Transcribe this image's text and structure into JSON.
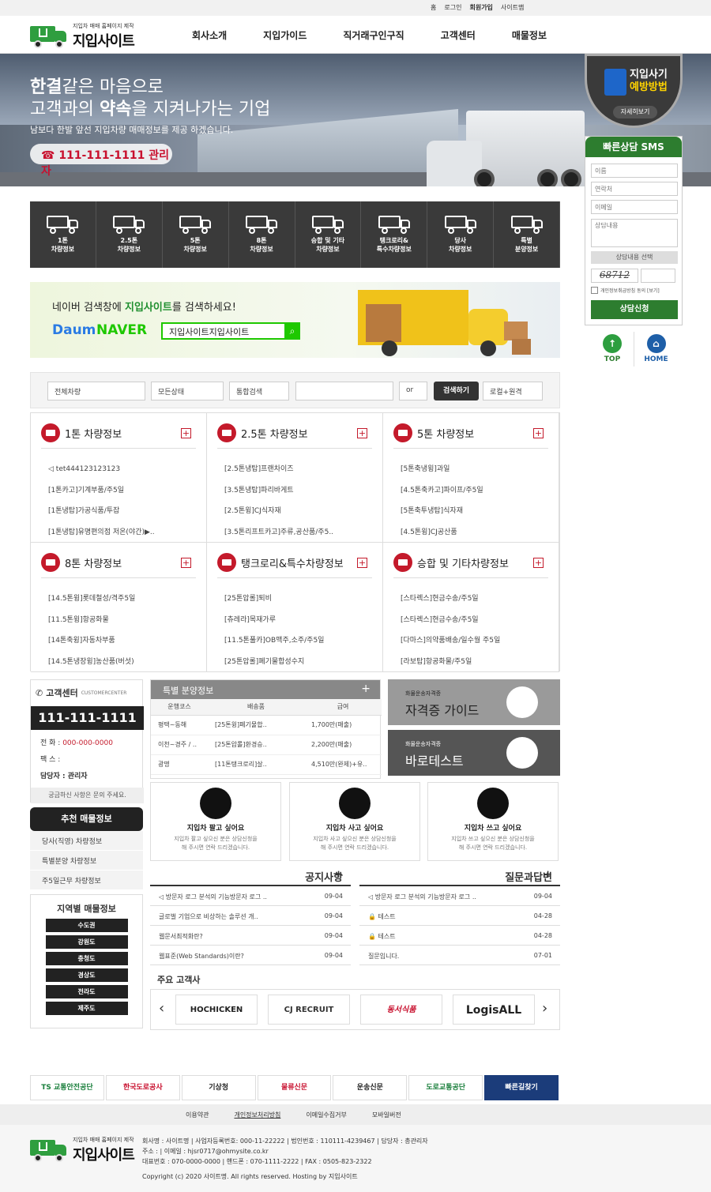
{
  "topbar": {
    "links": [
      "홈",
      "로그인",
      "회원가입",
      "사이트맵"
    ]
  },
  "logo": {
    "small": "지입차 매매 홈페이지 제작",
    "big": "지입사이트"
  },
  "gnb": [
    "회사소개",
    "지입가이드",
    "직거래구인구직",
    "고객센터",
    "매물정보"
  ],
  "hero": {
    "line1_bold": "한결",
    "line1_rest": "같은 마음으로",
    "line2_pre": "고객과의 ",
    "line2_bold": "약속",
    "line2_rest": "을 지켜나가는 기업",
    "sub": "남보다 한발 앞선 지입차량 매매정보를 제공 하겠습니다.",
    "phone": "☎ 111-111-1111 관리자"
  },
  "fraud": {
    "l1": "지입사기",
    "l2": "예방방법",
    "btn": "자세히보기"
  },
  "sms": {
    "title": "빠른상담 SMS",
    "name_ph": "이름",
    "phone_ph": "연락처",
    "email_ph": "이메일",
    "msg_ph": "상담내용",
    "select": "상담내용 선택",
    "captcha": "68712",
    "agree": "개인정보취급방침 동의 [보기]",
    "submit": "상담신청"
  },
  "quick": {
    "top": "TOP",
    "home": "HOME"
  },
  "categories": [
    {
      "l1": "1톤",
      "l2": "차량정보"
    },
    {
      "l1": "2.5톤",
      "l2": "차량정보"
    },
    {
      "l1": "5톤",
      "l2": "차량정보"
    },
    {
      "l1": "8톤",
      "l2": "차량정보"
    },
    {
      "l1": "승합 및 기타",
      "l2": "차량정보"
    },
    {
      "l1": "탱크로리&",
      "l2": "특수차량정보"
    },
    {
      "l1": "당사",
      "l2": "차량정보"
    },
    {
      "l1": "특별",
      "l2": "분양정보"
    }
  ],
  "banner": {
    "pre": "네이버 검색창에 ",
    "bold": "지입사이트",
    "post": "를 검색하세요!",
    "daum": "Daum",
    "naver": "NAVER",
    "query": "지입사이트지입사이트"
  },
  "search": {
    "s1": "전체차량",
    "s2": "모든상태",
    "s3": "통합검색",
    "op": "or",
    "go": "검색하기",
    "s4": "로컬+원격"
  },
  "boards": [
    {
      "title": "1톤 차량정보",
      "items": [
        "tet444123123123",
        "[1톤카고]기계부품/주5일",
        "[1톤냉탑]가공식품/투잡",
        "[1톤냉탑]유명편의점 저온(야간)▶.."
      ]
    },
    {
      "title": "2.5톤 차량정보",
      "items": [
        "[2.5톤냉탑]프랜차이즈",
        "[3.5톤냉탑]파리바게트",
        "[2.5톤윙]CJ식자재",
        "[3.5톤리프트카고]주류,공산품/주5.."
      ]
    },
    {
      "title": "5톤 차량정보",
      "items": [
        "[5톤축냉윙]과일",
        "[4.5톤축카고]파이프/주5일",
        "[5톤축투냉탑]식자재",
        "[4.5톤윙]CJ공산품"
      ]
    },
    {
      "title": "8톤 차량정보",
      "items": [
        "[14.5톤윙]롯데철성/격주5일",
        "[11.5톤윙]항공화물",
        "[14톤축윙]자동차부품",
        "[14.5톤냉장윙]농산품(버섯)"
      ]
    },
    {
      "title": "탱크로리&특수차량정보",
      "items": [
        "[25톤압롤]퇴비",
        "[츄레라]목재가루",
        "[11.5톤풀카]OB맥주,소주/주5일",
        "[25톤압롤]폐기물합성수지"
      ]
    },
    {
      "title": "승합 및 기타차량정보",
      "items": [
        "[스타렉스]현금수송/주5일",
        "[스타렉스]현금수송/주5일",
        "[다마스]의약품배송/일수월 주5일",
        "[라보탑]항공화물/주5일"
      ]
    }
  ],
  "cs": {
    "title": "고객센터",
    "title_en": "CUSTOMERCENTER",
    "num": "111-111-1111",
    "tel_label": "전   화 : ",
    "tel": "000-000-0000",
    "fax": "팩   스 :",
    "mgr": "담당자 : 관리자",
    "foot": "궁금하신 사항은 문의 주세요."
  },
  "rec": {
    "title": "추천 매물정보",
    "items": [
      "당사(직영) 차량정보",
      "특별분양 차량정보",
      "주5일근무 차량정보"
    ]
  },
  "region": {
    "title": "지역별 매물정보",
    "items": [
      "수도권",
      "강원도",
      "충청도",
      "경상도",
      "전라도",
      "제주도"
    ]
  },
  "special": {
    "title": "특별 분양정보",
    "plus": "+",
    "cols": [
      "운행코스",
      "배송품",
      "급여"
    ],
    "rows": [
      [
        "평택~동해",
        "[25톤윙]폐기물합..",
        "1,700만(매출)"
      ],
      [
        "이천~경주 / ..",
        "[25톤압롤]환경승..",
        "2,200만(매출)"
      ],
      [
        "광명",
        "[11톤탱크로리]살..",
        "4,510만(완제)+유.."
      ]
    ]
  },
  "guide": [
    {
      "s": "화물운송자격증",
      "b": "자격증 가이드"
    },
    {
      "s": "화물운송자격증",
      "b": "바로테스트"
    }
  ],
  "services": [
    {
      "t": "지입차 팔고 싶어요",
      "d1": "지입차 팔고 싶으신 분은 상담신청을",
      "d2": "해 주시면 연락 드리겠습니다."
    },
    {
      "t": "지입차 사고 싶어요",
      "d1": "지입차 사고 싶으신 분은 상담신청을",
      "d2": "해 주시면 연락 드리겠습니다."
    },
    {
      "t": "지입차 쓰고 싶어요",
      "d1": "지입차 쓰고 싶으신 분은 상담신청을",
      "d2": "해 주시면 연락 드리겠습니다."
    }
  ],
  "notice": {
    "title": "공지사항",
    "plus": "+",
    "items": [
      {
        "t": "방문자 로그 분석의 기능방문자 로그 ..",
        "d": "09-04"
      },
      {
        "t": "글로벌 기업으로 비상하는 솔루션 개..",
        "d": "09-04"
      },
      {
        "t": "웹문서최적화란?",
        "d": "09-04"
      },
      {
        "t": "웹표준(Web Standards)이란?",
        "d": "09-04"
      }
    ]
  },
  "qna": {
    "title": "질문과답변",
    "plus": "+",
    "items": [
      {
        "t": "방문자 로그 분석의 기능방문자 로그 ..",
        "d": "09-04"
      },
      {
        "t": "테스트",
        "d": "04-28"
      },
      {
        "t": "테스트",
        "d": "04-28"
      },
      {
        "t": "질문입니다.",
        "d": "07-01"
      }
    ]
  },
  "clients": {
    "title": "주요 고객사",
    "logos": [
      "HOCHICKEN",
      "CJ RECRUIT",
      "동서식품",
      "LogisALL"
    ]
  },
  "footlinks": [
    "TS 교통안전공단",
    "한국도로공사",
    "기상청",
    "물류신문",
    "운송신문",
    "도로교통공단",
    "빠른길찾기"
  ],
  "fbar": [
    "이용약관",
    "개인정보처리방침",
    "이메일수집거부",
    "모바일버전"
  ],
  "footer": {
    "l1": "회사명 : 사이트명 | 사업자등록번호: 000-11-22222 | 법인번호 : 110111-4239467 | 담당자 : 총관리자",
    "l2": "주소 : | 이메일 : hjsr0717@ohmysite.co.kr",
    "l3": "대표번호 : 070-0000-0000 | 핸드폰 : 070-1111-2222 | FAX : 0505-823-2322",
    "l4": "Copyright (c) 2020 사이트명. All rights reserved. Hosting by 지입사이트"
  },
  "colors": {
    "green": "#2d7d2f",
    "red": "#c41a2b",
    "dark": "#3a3a3a"
  }
}
